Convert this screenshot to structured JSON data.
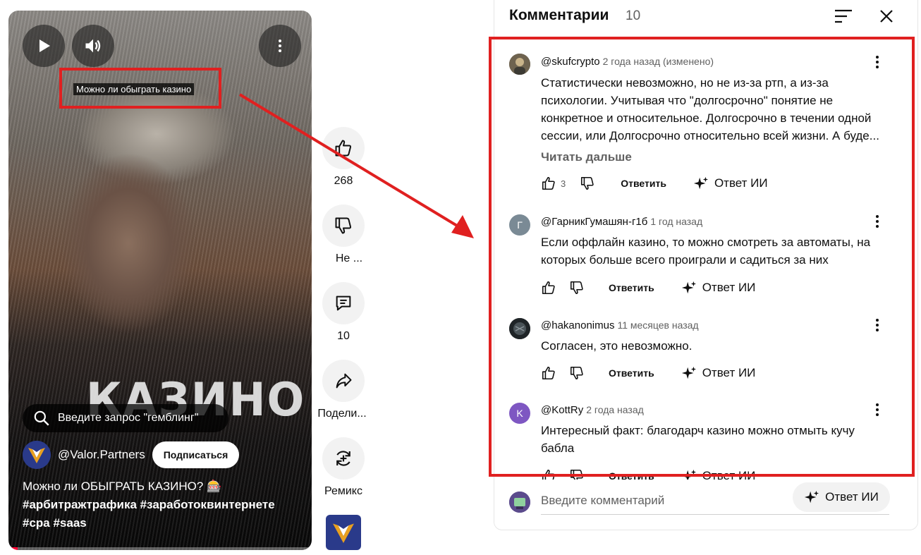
{
  "video": {
    "caption": "Можно ли обыграть казино",
    "overlay_text": "КАЗИНО",
    "search_prompt": "Введите запрос \"гемблинг\"",
    "channel": "@Valor.Partners",
    "subscribe_label": "Подписаться",
    "title_line": "Можно ли ОБЫГРАТЬ КАЗИНО? 🎰",
    "hashtags_line1": "#арбитражтрафика #заработоквинтернете",
    "hashtags_line2": "#cpa #saas",
    "progress_fraction": 0.03
  },
  "rail": {
    "likes": "268",
    "dislike_label": "Не ...",
    "comments": "10",
    "share_label": "Подели...",
    "remix_label": "Ремикс"
  },
  "comments_panel": {
    "title": "Комментарии",
    "count": "10",
    "items": [
      {
        "author": "@skufcrypto",
        "time": "2 года назад (изменено)",
        "text": "Статистически невозможно, но не из-за ртп, а из-за психологии.  Учитывая что \"долгосрочно\" понятие не конкретное и относительное. Долгосрочно в течении одной сессии, или Долгосрочно относительно всей жизни. А буде...",
        "read_more": "Читать дальше",
        "likes": "3",
        "reply": "Ответить",
        "ai_reply": "Ответ ИИ"
      },
      {
        "author": "@ГарникГумашян-г1б",
        "avatar_letter": "Г",
        "time": "1 год назад",
        "text": "Если оффлайн казино, то можно смотреть за автоматы, на которых больше всего проиграли и садиться за них",
        "reply": "Ответить",
        "ai_reply": "Ответ ИИ"
      },
      {
        "author": "@hakanonimus",
        "time": "11 месяцев назад",
        "text": "Согласен, это невозможно.",
        "reply": "Ответить",
        "ai_reply": "Ответ ИИ"
      },
      {
        "author": "@KottRy",
        "avatar_letter": "K",
        "time": "2 года назад",
        "text": "Интересный факт: благодарч казино можно отмыть кучу бабла",
        "reply": "Ответить",
        "ai_reply": "Ответ ИИ"
      }
    ],
    "composer_placeholder": "Введите комментарий",
    "composer_ai": "Ответ ИИ"
  },
  "colors": {
    "annotation_red": "#e02020",
    "progress_red": "#ff0033",
    "avatar_gray": "#7a8a95",
    "avatar_purple": "#7e57c2"
  }
}
